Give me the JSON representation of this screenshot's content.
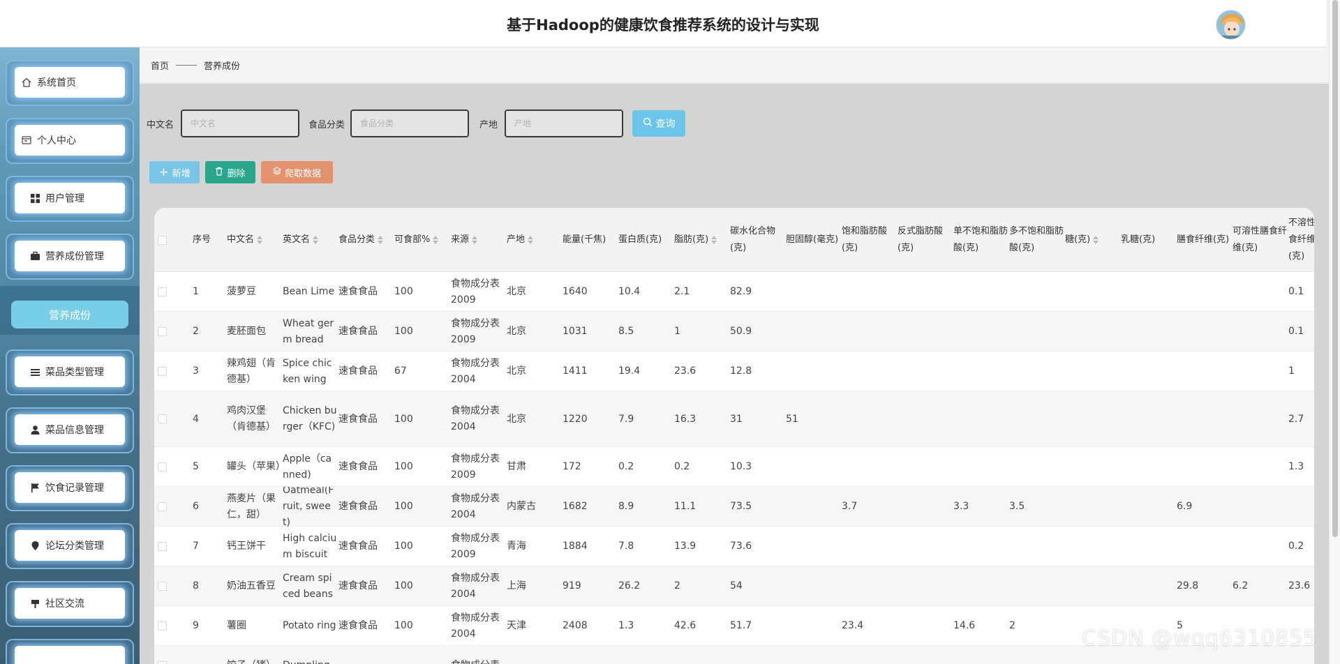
{
  "header": {
    "title": "基于Hadoop的健康饮食推荐系统的设计与实现"
  },
  "sidebar": {
    "items": [
      {
        "label": "系统首页",
        "icon": "home-icon"
      },
      {
        "label": "个人中心",
        "icon": "window-icon"
      },
      {
        "label": "用户管理",
        "icon": "grid-icon"
      },
      {
        "label": "营养成份管理",
        "icon": "briefcase-icon"
      },
      {
        "label": "菜品类型管理",
        "icon": "list-icon"
      },
      {
        "label": "菜品信息管理",
        "icon": "user-icon"
      },
      {
        "label": "饮食记录管理",
        "icon": "flag-icon"
      },
      {
        "label": "论坛分类管理",
        "icon": "pin-icon"
      },
      {
        "label": "社区交流",
        "icon": "sign-icon"
      }
    ],
    "active_sub": "营养成份"
  },
  "breadcrumb": {
    "home": "首页",
    "current": "营养成份"
  },
  "search": {
    "name_label": "中文名",
    "name_placeholder": "中文名",
    "category_label": "食品分类",
    "category_placeholder": "食品分类",
    "origin_label": "产地",
    "origin_placeholder": "产地",
    "query_label": "查询"
  },
  "actions": {
    "add": "新增",
    "delete": "删除",
    "crawl": "爬取数据"
  },
  "colors": {
    "add": "#79c5e6",
    "delete": "#29a68d",
    "crawl": "#e3916f",
    "query": "#6cc4ea",
    "active_sub": "#78cde7"
  },
  "table": {
    "columns": [
      "序号",
      "中文名",
      "英文名",
      "食品分类",
      "可食部%",
      "来源",
      "产地",
      "能量(千焦)",
      "蛋白质(克)",
      "脂肪(克)",
      "碳水化合物(克)",
      "胆固醇(毫克)",
      "饱和脂肪酸(克)",
      "反式脂肪酸(克)",
      "单不饱和脂肪酸(克)",
      "多不饱和脂肪酸(克)",
      "糖(克)",
      "乳糖(克)",
      "膳食纤维(克)",
      "可溶性膳食纤维(克)",
      "不溶性膳食纤维(克)"
    ],
    "rows": [
      [
        "1",
        "菠萝豆",
        "Bean Lime",
        "速食食品",
        "100",
        "食物成分表2009",
        "北京",
        "1640",
        "10.4",
        "2.1",
        "82.9",
        "",
        "",
        "",
        "",
        "",
        "",
        "",
        "",
        "",
        "0.1"
      ],
      [
        "2",
        "麦胚面包",
        "Wheat germ bread",
        "速食食品",
        "100",
        "食物成分表2009",
        "北京",
        "1031",
        "8.5",
        "1",
        "50.9",
        "",
        "",
        "",
        "",
        "",
        "",
        "",
        "",
        "",
        "0.1"
      ],
      [
        "3",
        "辣鸡翅（肯德基）",
        "Spice chicken wing",
        "速食食品",
        "67",
        "食物成分表2004",
        "北京",
        "1411",
        "19.4",
        "23.6",
        "12.8",
        "",
        "",
        "",
        "",
        "",
        "",
        "",
        "",
        "",
        "1"
      ],
      [
        "4",
        "鸡肉汉堡（肯德基）",
        "Chicken burger（KFC)",
        "速食食品",
        "100",
        "食物成分表2004",
        "北京",
        "1220",
        "7.9",
        "16.3",
        "31",
        "51",
        "",
        "",
        "",
        "",
        "",
        "",
        "",
        "",
        "2.7"
      ],
      [
        "5",
        "罐头（苹果）",
        "Apple（canned)",
        "速食食品",
        "100",
        "食物成分表2009",
        "甘肃",
        "172",
        "0.2",
        "0.2",
        "10.3",
        "",
        "",
        "",
        "",
        "",
        "",
        "",
        "",
        "",
        "1.3"
      ],
      [
        "6",
        "燕麦片（果仁，甜）",
        "Oatmeal(Fruit, sweet)",
        "速食食品",
        "100",
        "食物成分表2004",
        "内蒙古",
        "1682",
        "8.9",
        "11.1",
        "73.5",
        "",
        "3.7",
        "",
        "3.3",
        "3.5",
        "",
        "",
        "6.9",
        "",
        ""
      ],
      [
        "7",
        "钙王饼干",
        "High calcium biscuit",
        "速食食品",
        "100",
        "食物成分表2009",
        "青海",
        "1884",
        "7.8",
        "13.9",
        "73.6",
        "",
        "",
        "",
        "",
        "",
        "",
        "",
        "",
        "",
        "0.2"
      ],
      [
        "8",
        "奶油五香豆",
        "Cream spiced beans",
        "速食食品",
        "100",
        "食物成分表2004",
        "上海",
        "919",
        "26.2",
        "2",
        "54",
        "",
        "",
        "",
        "",
        "",
        "",
        "",
        "29.8",
        "6.2",
        "23.6"
      ],
      [
        "9",
        "薯圈",
        "Potato ring",
        "速食食品",
        "100",
        "食物成分表2004",
        "天津",
        "2408",
        "1.3",
        "42.6",
        "51.7",
        "",
        "23.4",
        "",
        "14.6",
        "2",
        "",
        "",
        "5",
        "",
        ""
      ],
      [
        "",
        "饺子（猪）",
        "Dumpling",
        "",
        "",
        "食物成分表",
        "",
        "",
        "",
        "",
        "",
        "",
        "",
        "",
        "",
        "",
        "",
        "",
        "",
        "",
        ""
      ]
    ]
  },
  "watermark": "CSDN @wqq6310855"
}
